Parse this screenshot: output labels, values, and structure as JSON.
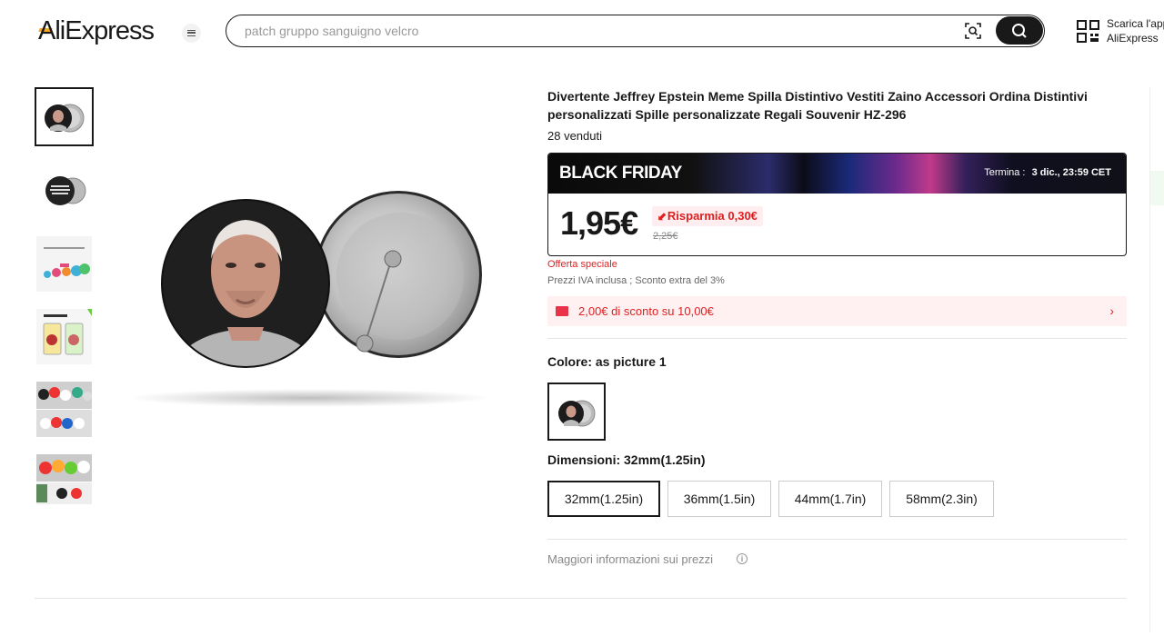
{
  "header": {
    "logo": "AliExpress",
    "search_placeholder": "patch gruppo sanguigno velcro",
    "app_line1": "Scarica l'app",
    "app_line2": "AliExpress"
  },
  "product": {
    "title": "Divertente Jeffrey Epstein Meme Spilla Distintivo Vestiti Zaino Accessori Ordina Distintivi personalizzati Spille personalizzate Regali Souvenir HZ-296",
    "sold": "28 venduti",
    "promo": {
      "title": "BLACK FRIDAY",
      "ends_label": "Termina :",
      "ends_value": "3 dic., 23:59 CET"
    },
    "price": "1,95€",
    "save": "Risparmia 0,30€",
    "old_price": "2,25€",
    "offer": "Offerta speciale",
    "tax": "Prezzi IVA inclusa ; Sconto extra del 3%",
    "coupon": "2,00€ di sconto su 10,00€",
    "color_label": "Colore: as picture 1",
    "size_label": "Dimensioni: 32mm(1.25in)",
    "sizes": [
      "32mm(1.25in)",
      "36mm(1.5in)",
      "44mm(1.7in)",
      "58mm(2.3in)"
    ],
    "selected_size": "32mm(1.25in)",
    "more_info": "Maggiori informazioni sui prezzi"
  },
  "colors": {
    "accent_red": "#e02020",
    "text": "#191919",
    "logo_accent": "#f5a623"
  },
  "icons": [
    "menu-icon",
    "camera-search-icon",
    "search-icon",
    "qr-code-icon",
    "coupon-tag-icon",
    "chevron-right-icon",
    "info-icon"
  ]
}
